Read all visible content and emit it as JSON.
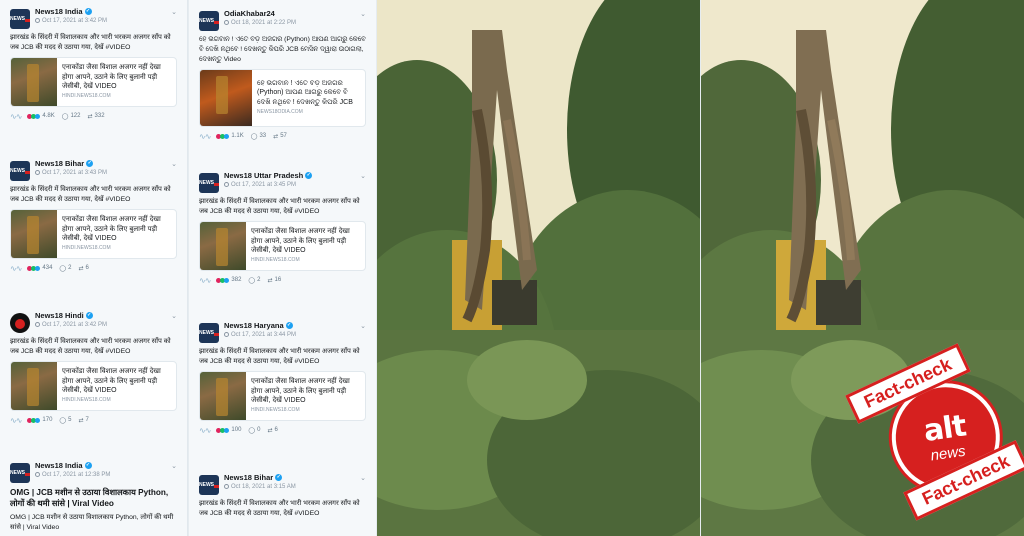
{
  "tweets_left": [
    {
      "name": "News18 India",
      "date": "Oct 17, 2021 at 3:42 PM",
      "text": "झारखंड के सिंदरी में विशालकाय और भारी भरकम अजगर साँप को जब JCB की मदद से उठाया गया, देखें #VIDEO",
      "card_title": "एनाकोंडा जैसा विशाल अजगर नहीं देखा होगा आपने, उठाने के लिए बुलानी पड़ी जेसीबी, देखें VIDEO",
      "card_src": "HINDI.NEWS18.COM",
      "likes": "4.8K",
      "replies": "122",
      "retweets": "332"
    },
    {
      "name": "News18 Bihar",
      "date": "Oct 17, 2021 at 3:43 PM",
      "text": "झारखंड के सिंदरी में विशालकाय और भारी भरकम अजगर साँप को जब JCB की मदद से उठाया गया, देखें #VIDEO",
      "card_title": "एनाकोंडा जैसा विशाल अजगर नहीं देखा होगा आपने, उठाने के लिए बुलानी पड़ी जेसीबी, देखें VIDEO",
      "card_src": "HINDI.NEWS18.COM",
      "likes": "434",
      "replies": "2",
      "retweets": "6"
    },
    {
      "name": "News18 Hindi",
      "date": "Oct 17, 2021 at 3:42 PM",
      "text": "झारखंड के सिंदरी में विशालकाय और भारी भरकम अजगर साँप को जब JCB की मदद से उठाया गया, देखें #VIDEO",
      "card_title": "एनाकोंडा जैसा विशाल अजगर नहीं देखा होगा आपने, उठाने के लिए बुलानी पड़ी जेसीबी, देखें VIDEO",
      "card_src": "HINDI.NEWS18.COM",
      "likes": "170",
      "replies": "5",
      "retweets": "7"
    },
    {
      "name": "News18 India",
      "date": "Oct 17, 2021 at 12:38 PM",
      "text": "OMG | JCB मशीन से उठाया विशालकाय Python, लोगों की थमी सांसे | Viral Video",
      "text2": "OMG | JCB मशीन से उठाया विशालकाय Python, लोगों की थमी सांसे | Viral Video"
    }
  ],
  "tweets_mid": [
    {
      "name": "OdiaKhabar24",
      "date": "Oct 18, 2021 at 2:22 PM",
      "text": "ହେ ଭଗବାନ ! ଏତେ ବଡ଼ ଅଜଗର (Python) ଆପଣ ଆଗରୁ କେବେ ବି ଦେଖି ନଥିବେ ! ଦେଖନ୍ତୁ କିପରି JCB ମେସିନ ଦ୍ୱାରା ଉଠାଗଲା, ଦେଖନ୍ତୁ Video",
      "card_title": "ହେ ଭଗବାନ ! ଏତେ ବଡ଼ ଅଜଗର (Python) ଆପଣ ଆଗରୁ କେବେ ବି ଦେଖି ନଥିବେ ! ଦେଖନ୍ତୁ କିପରି JCB",
      "card_src": "NEWS18ODIA.COM",
      "likes": "1.1K",
      "replies": "33",
      "retweets": "57"
    },
    {
      "name": "News18 Uttar Pradesh",
      "date": "Oct 17, 2021 at 3:45 PM",
      "text": "झारखंड के सिंदरी में विशालकाय और भारी भरकम अजगर साँप को जब JCB की मदद से उठाया गया, देखें #VIDEO",
      "card_title": "एनाकोंडा जैसा विशाल अजगर नहीं देखा होगा आपने, उठाने के लिए बुलानी पड़ी जेसीबी, देखें VIDEO",
      "card_src": "HINDI.NEWS18.COM",
      "likes": "382",
      "replies": "2",
      "retweets": "16"
    },
    {
      "name": "News18 Haryana",
      "date": "Oct 17, 2021 at 3:44 PM",
      "text": "झारखंड के सिंदरी में विशालकाय और भारी भरकम अजगर साँप को जब JCB की मदद से उठाया गया, देखें #VIDEO",
      "card_title": "एनाकोंडा जैसा विशाल अजगर नहीं देखा होगा आपने, उठाने के लिए बुलानी पड़ी जेसीबी, देखें VIDEO",
      "card_src": "HINDI.NEWS18.COM",
      "likes": "100",
      "replies": "0",
      "retweets": "6"
    },
    {
      "name": "News18 Bihar",
      "date": "Oct 18, 2021 at 3:15 AM",
      "text": "झारखंड के सिंदरी में विशालकाय और भारी भरकम अजगर साँप को जब JCB की मदद से उठाया गया, देखें #VIDEO"
    }
  ],
  "stamp": {
    "top": "Fact-check",
    "bottom": "Fact-check",
    "logo": "alt",
    "logo_sub": "news"
  },
  "colors": {
    "verified": "#1da1f2",
    "stamp_red": "#d6201f",
    "photo_sky": "#efe9cf",
    "foliage": "#4d6b3a"
  }
}
